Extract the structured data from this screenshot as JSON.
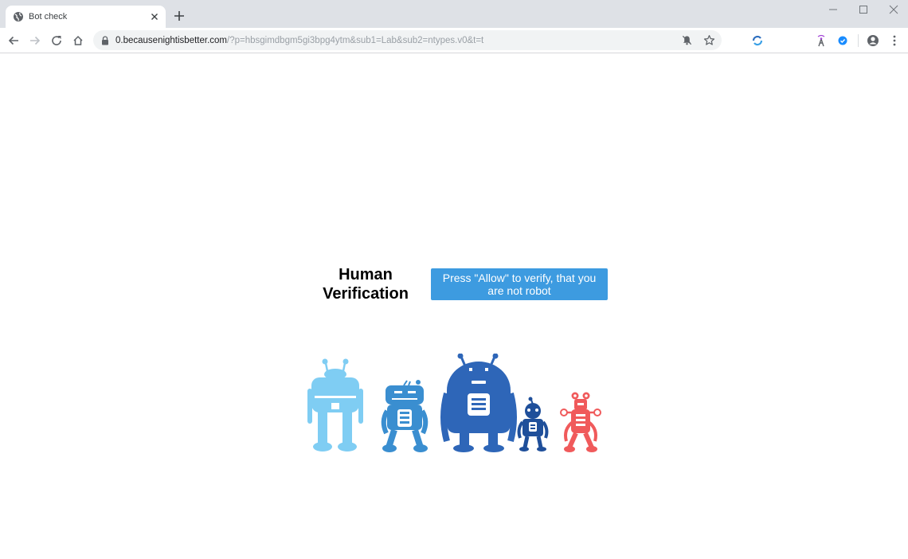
{
  "browser": {
    "tab": {
      "title": "Bot check"
    },
    "address": {
      "host": "0.becausenightisbetter.com",
      "path": "/?p=hbsgimdbgm5gi3bpg4ytm&sub1=Lab&sub2=ntypes.v0&t=t"
    },
    "extensions": [
      {
        "name": "sync-circle-icon"
      },
      {
        "name": "signal-tower-icon"
      },
      {
        "name": "check-circle-icon"
      }
    ]
  },
  "page": {
    "heading": "Human Verification",
    "button_label": "Press \"Allow\" to verify, that you are not robot"
  },
  "colors": {
    "button": "#3d9be0",
    "robot_light_blue": "#7fcdf3",
    "robot_mid_blue": "#3a8ed0",
    "robot_dark_blue": "#2e66b8",
    "robot_navy": "#1f4f9a",
    "robot_red": "#f05a5b"
  }
}
